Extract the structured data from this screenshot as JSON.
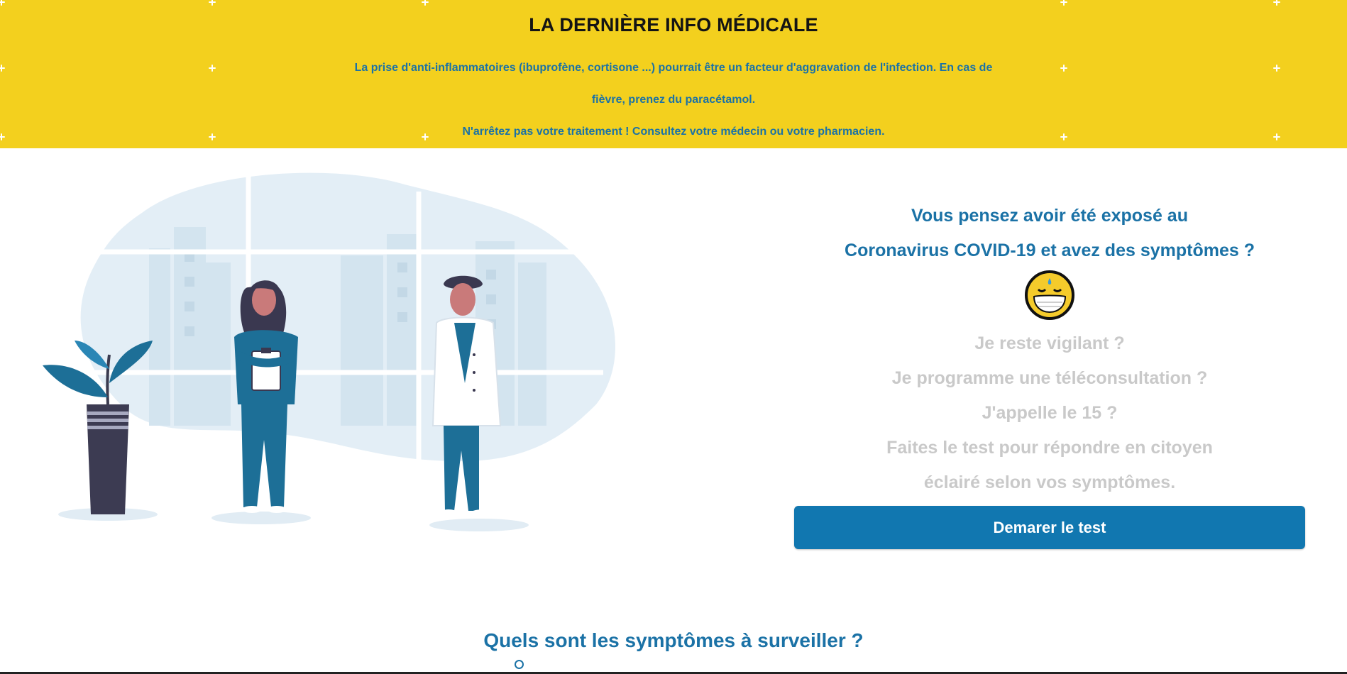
{
  "banner": {
    "title": "LA DERNIÈRE INFO MÉDICALE",
    "line1": "La prise d'anti-inflammatoires (ibuprofène, cortisone ...) pourrait être un facteur d'aggravation de l'infection. En cas de",
    "line2": "fièvre, prenez du paracétamol.",
    "line3": "N'arrêtez pas votre traitement ! Consultez votre médecin ou votre pharmacien.",
    "background_color": "#F3D01E",
    "text_color": "#1B72A6"
  },
  "hero": {
    "illustration_icon": "doctors-illustration",
    "headline_line1": "Vous pensez avoir été exposé au",
    "headline_line2": "Coronavirus COVID-19 et avez des symptômes ?",
    "emoji_icon": "face-with-medical-mask-icon",
    "questions": [
      "Je reste vigilant ?",
      "Je programme une téléconsultation ?",
      "J'appelle le 15 ?",
      "Faites le test pour répondre en citoyen",
      "éclairé selon vos symptômes."
    ],
    "cta_label": "Demarer le test",
    "accent_color": "#1177B0"
  },
  "symptoms_section": {
    "title": "Quels sont les symptômes à surveiller ?"
  }
}
